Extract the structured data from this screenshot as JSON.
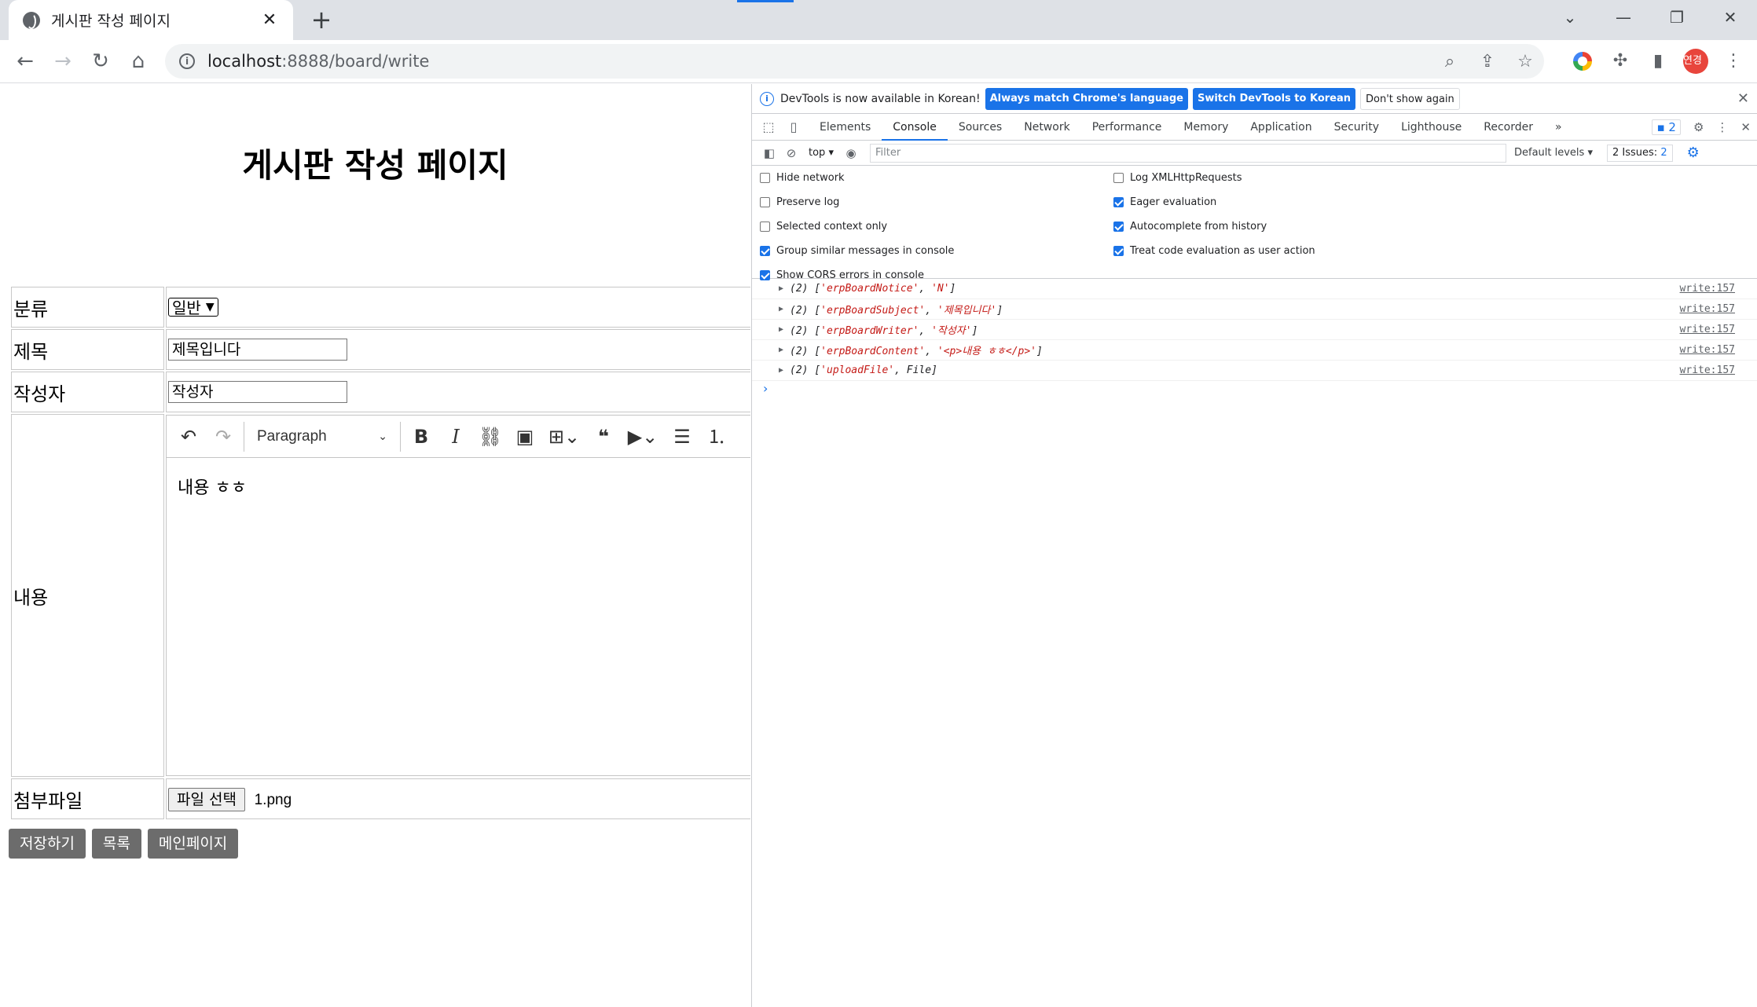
{
  "browser": {
    "tab_title": "게시판 작성 페이지",
    "url_host": "localhost",
    "url_rest": ":8888/board/write",
    "profile_initials": "연경"
  },
  "page": {
    "title": "게시판 작성 페이지",
    "form": {
      "category_label": "분류",
      "category_value": "일반",
      "subject_label": "제목",
      "subject_value": "제목입니다",
      "writer_label": "작성자",
      "writer_value": "작성자",
      "content_label": "내용",
      "editor_paragraph": "Paragraph",
      "content_value": "내용 ㅎㅎ",
      "file_label": "첨부파일",
      "file_button": "파일 선택",
      "file_name": "1.png"
    },
    "buttons": {
      "save": "저장하기",
      "list": "목록",
      "main": "메인페이지"
    }
  },
  "devtools": {
    "infobar": {
      "message": "DevTools is now available in Korean!",
      "match_button": "Always match Chrome's language",
      "switch_button": "Switch DevTools to Korean",
      "dismiss_button": "Don't show again"
    },
    "tabs": [
      "Elements",
      "Console",
      "Sources",
      "Network",
      "Performance",
      "Memory",
      "Application",
      "Security",
      "Lighthouse",
      "Recorder"
    ],
    "badge_count": "2",
    "context": "top",
    "filter_placeholder": "Filter",
    "levels": "Default levels",
    "issues_label": "2 Issues:",
    "issues_count": "2",
    "settings_left": [
      {
        "label": "Hide network",
        "checked": false
      },
      {
        "label": "Preserve log",
        "checked": false
      },
      {
        "label": "Selected context only",
        "checked": false
      },
      {
        "label": "Group similar messages in console",
        "checked": true
      },
      {
        "label": "Show CORS errors in console",
        "checked": true
      }
    ],
    "settings_right": [
      {
        "label": "Log XMLHttpRequests",
        "checked": false
      },
      {
        "label": "Eager evaluation",
        "checked": true
      },
      {
        "label": "Autocomplete from history",
        "checked": true
      },
      {
        "label": "Treat code evaluation as user action",
        "checked": true
      }
    ],
    "logs": [
      {
        "prefix": "(2) [",
        "key": "'erpBoardNotice'",
        "sep": ", ",
        "value": "'N'",
        "suffix": "]",
        "source": "write:157"
      },
      {
        "prefix": "(2) [",
        "key": "'erpBoardSubject'",
        "sep": ", ",
        "value": "'제목입니다'",
        "suffix": "]",
        "source": "write:157"
      },
      {
        "prefix": "(2) [",
        "key": "'erpBoardWriter'",
        "sep": ", ",
        "value": "'작성자'",
        "suffix": "]",
        "source": "write:157"
      },
      {
        "prefix": "(2) [",
        "key": "'erpBoardContent'",
        "sep": ", ",
        "value": "'<p>내용 ㅎㅎ</p>'",
        "suffix": "]",
        "source": "write:157"
      },
      {
        "prefix": "(2) [",
        "key": "'uploadFile'",
        "sep": ", ",
        "value": "File",
        "suffix": "]",
        "source": "write:157"
      }
    ]
  }
}
